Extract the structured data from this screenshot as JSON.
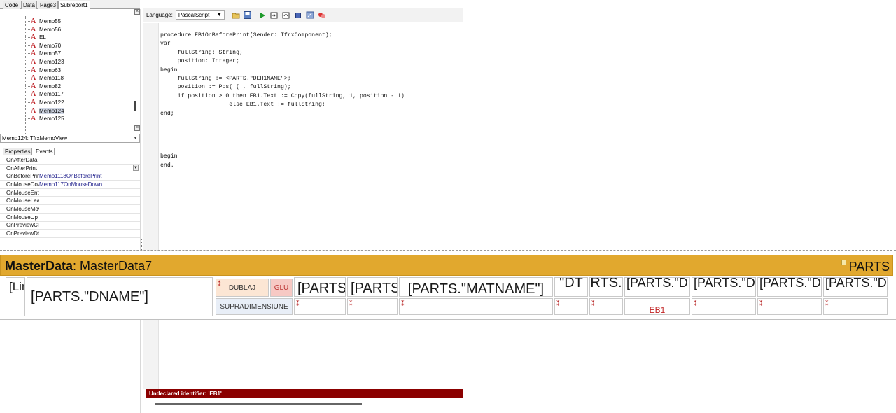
{
  "top_tabs": [
    "Code",
    "Data",
    "Page3",
    "Subreport1"
  ],
  "tree": {
    "items": [
      "Memo55",
      "Memo56",
      "EL",
      "Memo70",
      "Memo57",
      "Memo123",
      "Memo63",
      "Memo118",
      "Memo82",
      "Memo117",
      "Memo122",
      "Memo124",
      "Memo125"
    ],
    "selected": "Memo124",
    "icon_glyph": "A"
  },
  "object_combo": "Memo124: TfrxMemoView",
  "prop_tabs": [
    "Properties",
    "Events"
  ],
  "events": [
    {
      "name": "OnAfterData",
      "value": ""
    },
    {
      "name": "OnAfterPrint",
      "value": ""
    },
    {
      "name": "OnBeforePrint",
      "value": "Memo1118OnBeforePrint"
    },
    {
      "name": "OnMouseDown",
      "value": "Memo117OnMouseDown"
    },
    {
      "name": "OnMouseEnter",
      "value": ""
    },
    {
      "name": "OnMouseLeave",
      "value": ""
    },
    {
      "name": "OnMouseMove",
      "value": ""
    },
    {
      "name": "OnMouseUp",
      "value": ""
    },
    {
      "name": "OnPreviewClick",
      "value": ""
    },
    {
      "name": "OnPreviewDblClick",
      "value": ""
    }
  ],
  "toolbar": {
    "language_label": "Language:",
    "language_value": "PascalScript"
  },
  "code_lines": [
    "procedure EB1OnBeforePrint(Sender: TfrxComponent);",
    "var",
    "     fullString: String;",
    "     position: Integer;",
    "begin",
    "     fullString := <PARTS.\"DEH1NAME\">;",
    "     position := Pos('(', fullString);",
    "     if position > 0 then EB1.Text := Copy(fullString, 1, position - 1)",
    "                    else EB1.Text := fullString;",
    "end;",
    "",
    "",
    "",
    "",
    "begin",
    "end."
  ],
  "error_message": "Undeclared identifier: 'EB1'",
  "band": {
    "title_bold": "MasterData",
    "title_rest": ": MasterData7",
    "dataset": "PARTS"
  },
  "cells": {
    "line": "[Line]",
    "dname": "[PARTS.\"DNAME\"]",
    "dublaj": "DUBLAJ",
    "glu": "GLU",
    "supradim": "SUPRADIMENSIUNE",
    "parts1": "[PARTS",
    "parts2": "[PARTS",
    "matname": "[PARTS.\"MATNAME\"]",
    "dt": "\"DT",
    "rts": "RTS.",
    "de1": "[PARTS.\"DE",
    "de2": "[PARTS.\"DE",
    "de3": "[PARTS.\"DE",
    "de4": "[PARTS.\"DE",
    "eb1": "EB1"
  }
}
